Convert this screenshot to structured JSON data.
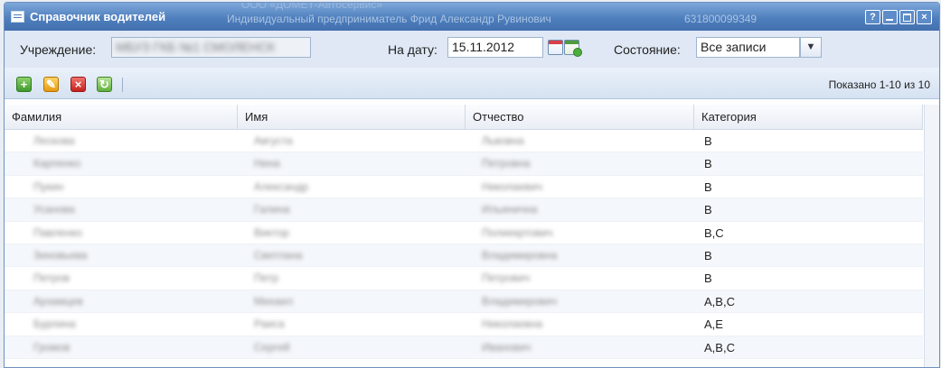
{
  "window": {
    "title": "Справочник водителей",
    "ghost_top": "ООО «ДОМЕТ-Автосервис»",
    "ghost_text": "Индивидуальный предприниматель Фрид Александр Рувинович",
    "ghost_number": "631800099349",
    "buttons": {
      "help": "?",
      "minimize": "_",
      "maximize": "□",
      "close": "×"
    }
  },
  "filters": {
    "institution_label": "Учреждение:",
    "institution_value": "МБУЗ ГКБ №1 СМОЛЕНСК",
    "date_label": "На дату:",
    "date_value": "15.11.2012",
    "status_label": "Состояние:",
    "status_value": "Все записи"
  },
  "toolbar": {
    "paging": "Показано 1-10 из 10"
  },
  "grid": {
    "columns": [
      "Фамилия",
      "Имя",
      "Отчество",
      "Категория"
    ],
    "rows": [
      {
        "last": "Лескова",
        "first": "Августа",
        "middle": "Львовна",
        "category": "B"
      },
      {
        "last": "Карпенко",
        "first": "Нина",
        "middle": "Петровна",
        "category": "B"
      },
      {
        "last": "Пукин",
        "first": "Александр",
        "middle": "Николаевич",
        "category": "B"
      },
      {
        "last": "Усанова",
        "first": "Галина",
        "middle": "Ильинична",
        "category": "B"
      },
      {
        "last": "Павленко",
        "first": "Виктор",
        "middle": "Полиекртович",
        "category": "B,C"
      },
      {
        "last": "Зиновьева",
        "first": "Светлана",
        "middle": "Владимировна",
        "category": "B"
      },
      {
        "last": "Петров",
        "first": "Петр",
        "middle": "Петрович",
        "category": "B"
      },
      {
        "last": "Арзамцев",
        "first": "Михаил",
        "middle": "Владимирович",
        "category": "A,B,C"
      },
      {
        "last": "Бурлина",
        "first": "Раиса",
        "middle": "Николаевна",
        "category": "A,E"
      },
      {
        "last": "Громов",
        "first": "Сергей",
        "middle": "Иванович",
        "category": "A,B,C"
      }
    ]
  }
}
